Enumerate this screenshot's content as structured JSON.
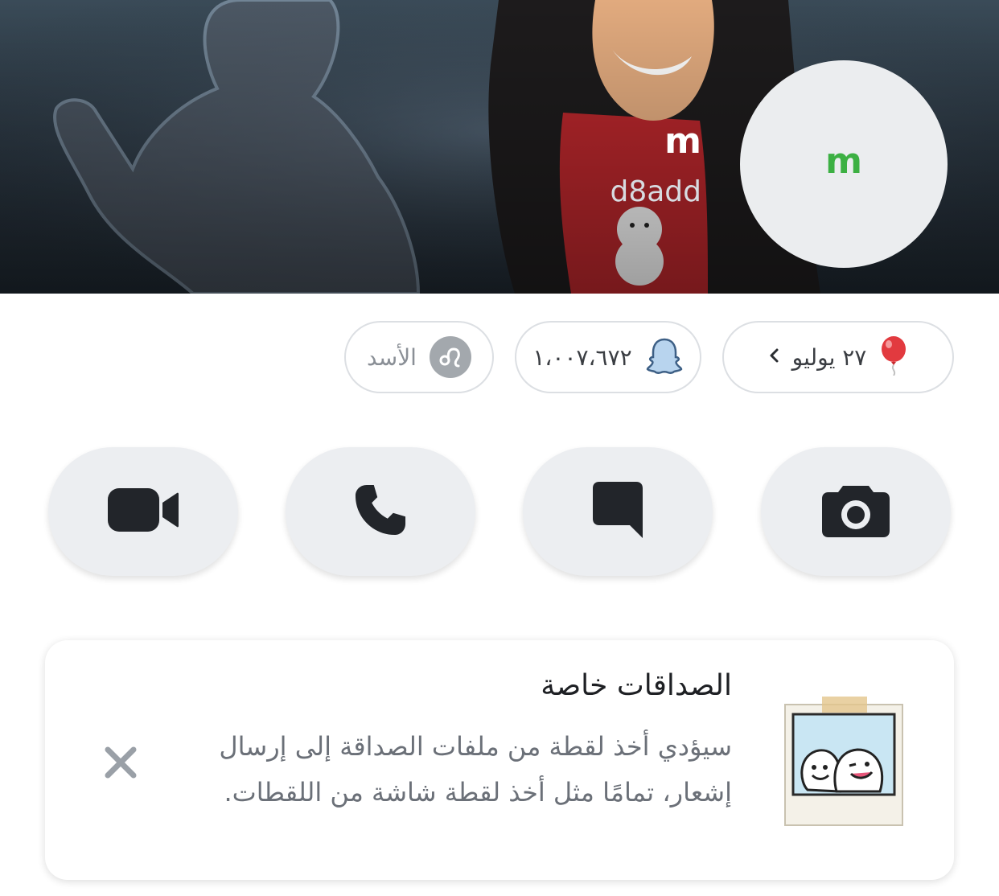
{
  "profile": {
    "display_name": "m",
    "username": "d8add",
    "avatar_letter": "m"
  },
  "chips": {
    "birthday_text": "٢٧ يوليو",
    "score_text": "١،٠٠٧،٦٧٢",
    "zodiac_text": "الأسد"
  },
  "actions": [
    "camera",
    "chat",
    "call",
    "video-call"
  ],
  "card": {
    "title": "الصداقات خاصة",
    "body": "سيؤدي أخذ لقطة من ملفات الصداقة إلى إرسال إشعار، تمامًا مثل أخذ لقطة شاشة من اللقطات."
  },
  "colors": {
    "header_bg": "#2b3742",
    "avatar_letter": "#3cb043",
    "chip_border": "#dcdfe3",
    "action_bg": "#eceef1",
    "icon": "#22252a"
  },
  "icons": {
    "birthday": "balloon-icon",
    "score": "snap-ghost-icon",
    "zodiac": "leo-icon",
    "chevron": "chevron-icon",
    "close": "close-icon"
  }
}
